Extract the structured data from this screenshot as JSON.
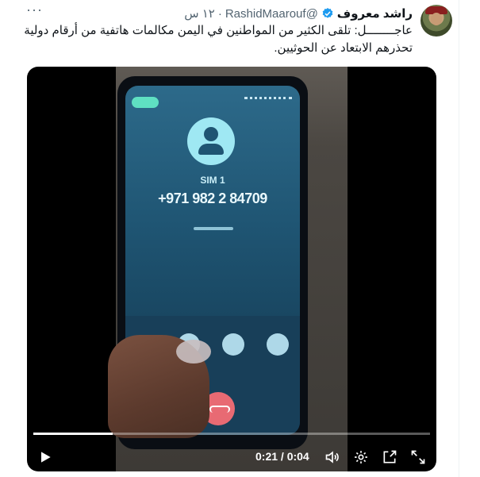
{
  "tweet": {
    "display_name": "راشد معروف",
    "handle": "@RashidMaarouf",
    "separator": "·",
    "time": "١٢ س",
    "text_line1": "عاجــــــــل: تلقى الكثير من المواطنين في اليمن مكالمات هاتفية من أرقام دولية",
    "text_line2": "تحذرهم الابتعاد عن الحوثيين.",
    "more_label": "···"
  },
  "video": {
    "screen_sim_label": "SIM 1",
    "screen_number": "+971 982 2 84709",
    "current_time": "0:21",
    "duration": "0:04",
    "timecode": "0:21 / 0:04",
    "progress": 0.2
  },
  "icons": {
    "verified": "verified-badge-icon",
    "play": "play-icon",
    "volume": "volume-icon",
    "settings": "gear-icon",
    "popout": "popout-icon",
    "fullscreen": "fullscreen-icon"
  },
  "colors": {
    "verified": "#1d9bf0",
    "secondary_text": "#536471",
    "video_bg": "#000000"
  }
}
